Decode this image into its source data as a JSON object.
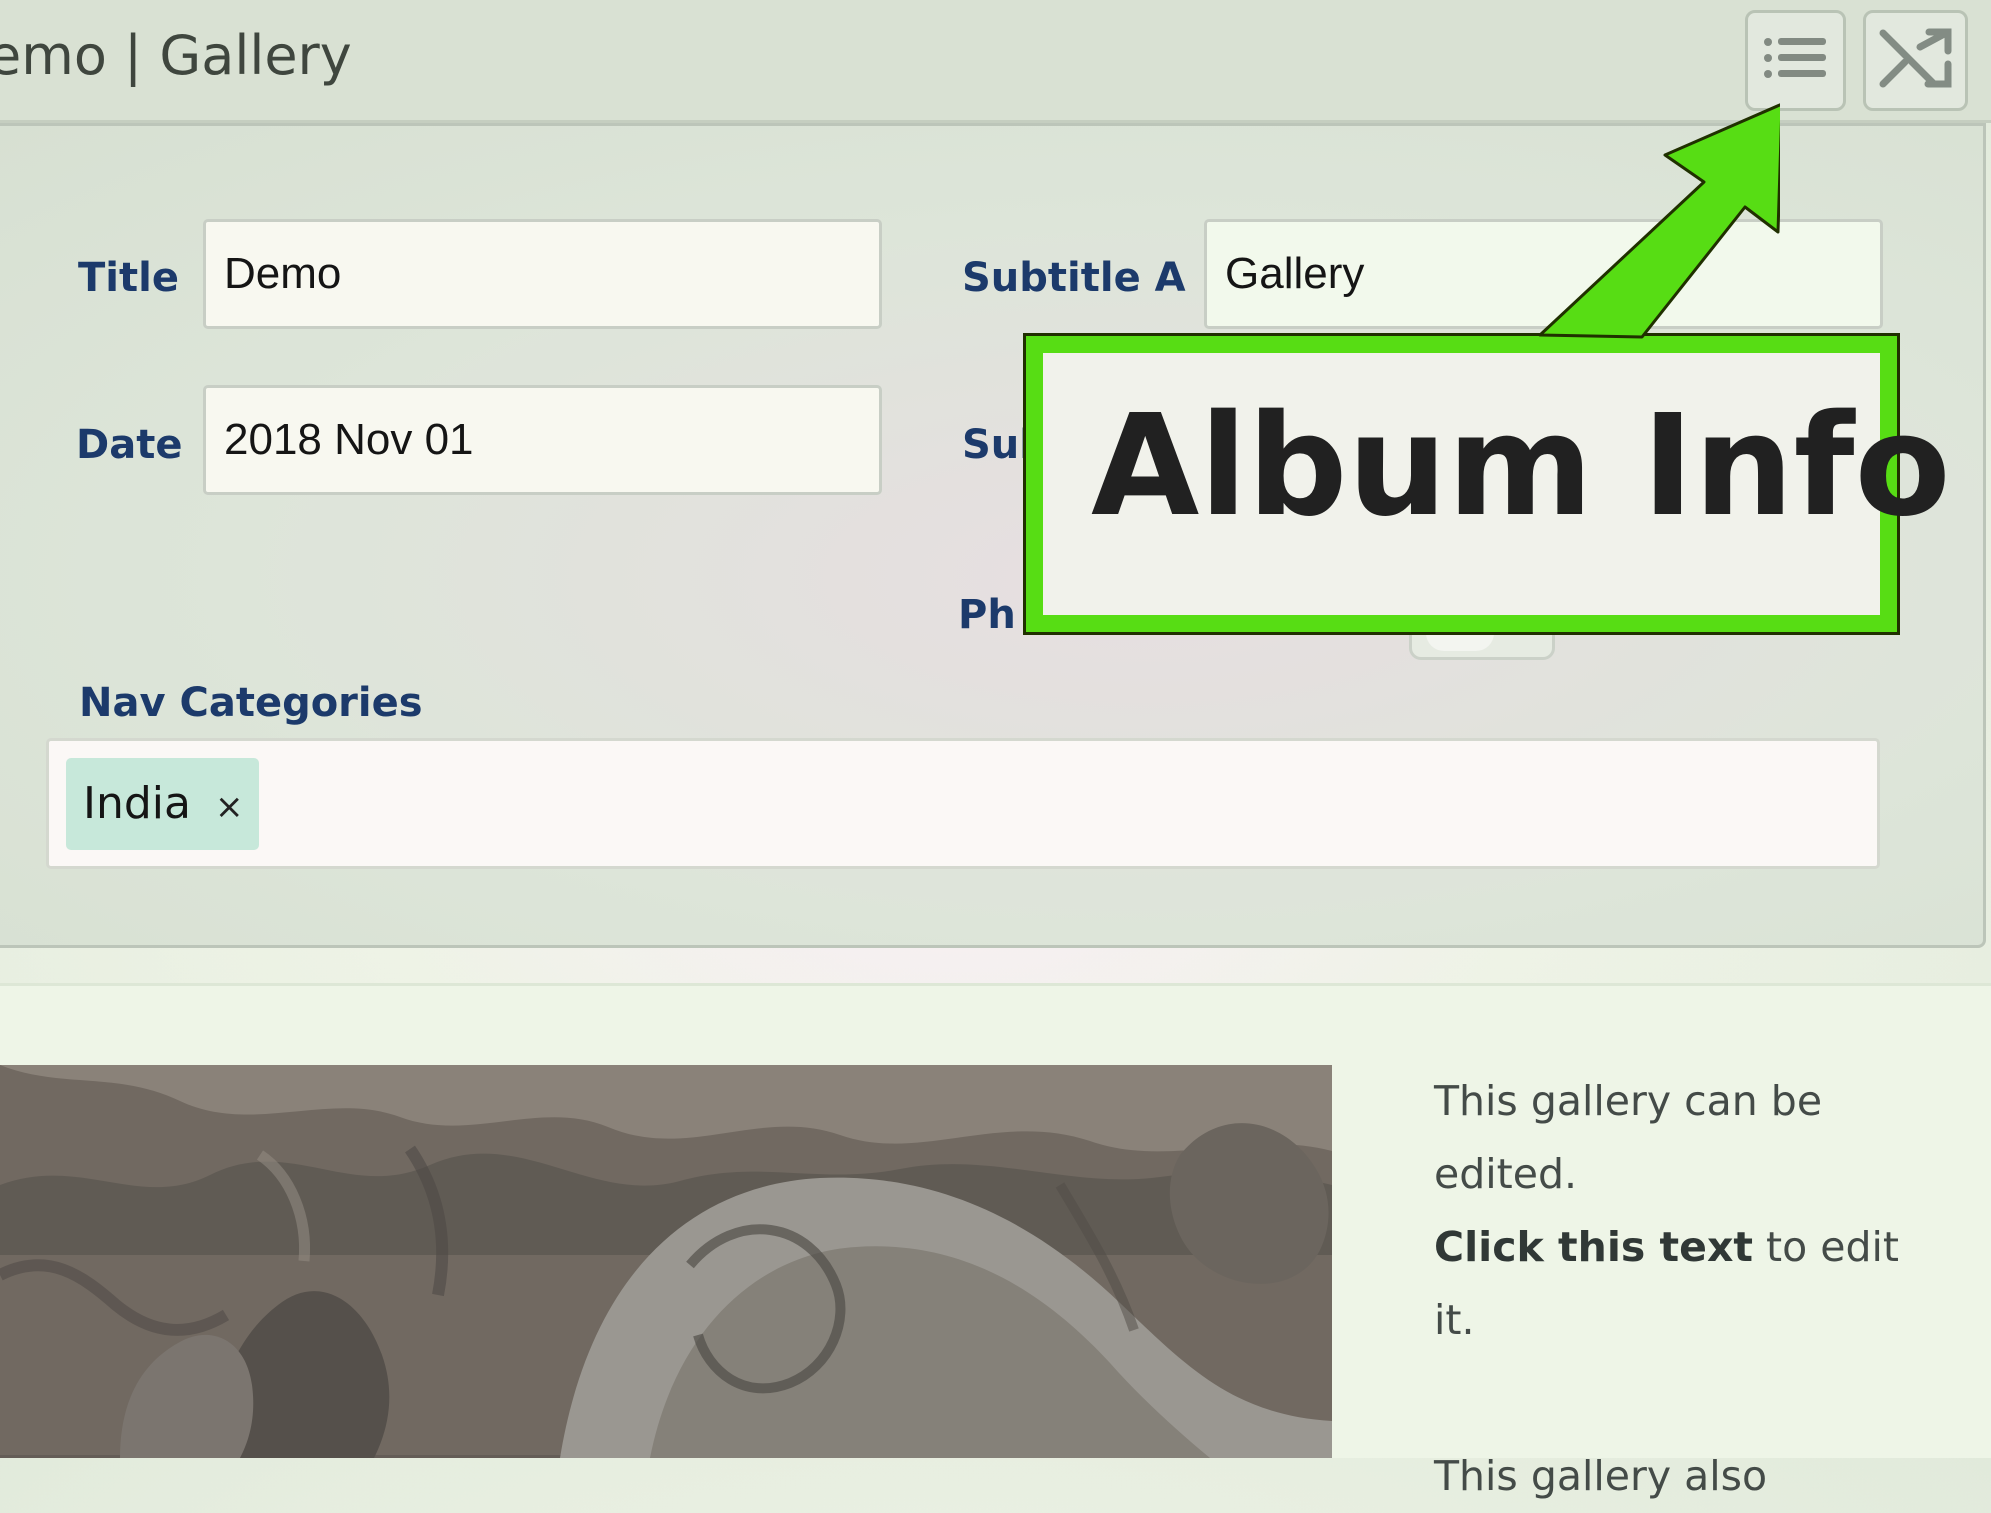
{
  "window": {
    "title": "emo | Gallery"
  },
  "toolbar": {
    "menu_icon": "list-menu-icon",
    "shuffle_icon": "shuffle-icon"
  },
  "album_form": {
    "title_label": "Title",
    "title_value": "Demo",
    "date_label": "Date",
    "date_value": "2018 Nov 01",
    "subtitle_a_label": "Subtitle A",
    "subtitle_a_value": "Gallery",
    "subtitle_b_label_partial": "Sul",
    "photo_label_partial": "Ph",
    "nav_categories_label": "Nav Categories",
    "nav_categories": [
      {
        "label": "India",
        "remove_symbol": "×"
      }
    ]
  },
  "callout": {
    "label": "Album Info",
    "accent_color": "#57dd14"
  },
  "gallery": {
    "image_subject": "stone-elephant-carving-image",
    "description_line_1": "This gallery can be edited.",
    "description_bold": "Click this text",
    "description_rest": " to edit it.",
    "description_next_partial": "This gallery also"
  },
  "colors": {
    "label_blue": "#1c3a6b",
    "callout_green": "#57dd14"
  }
}
